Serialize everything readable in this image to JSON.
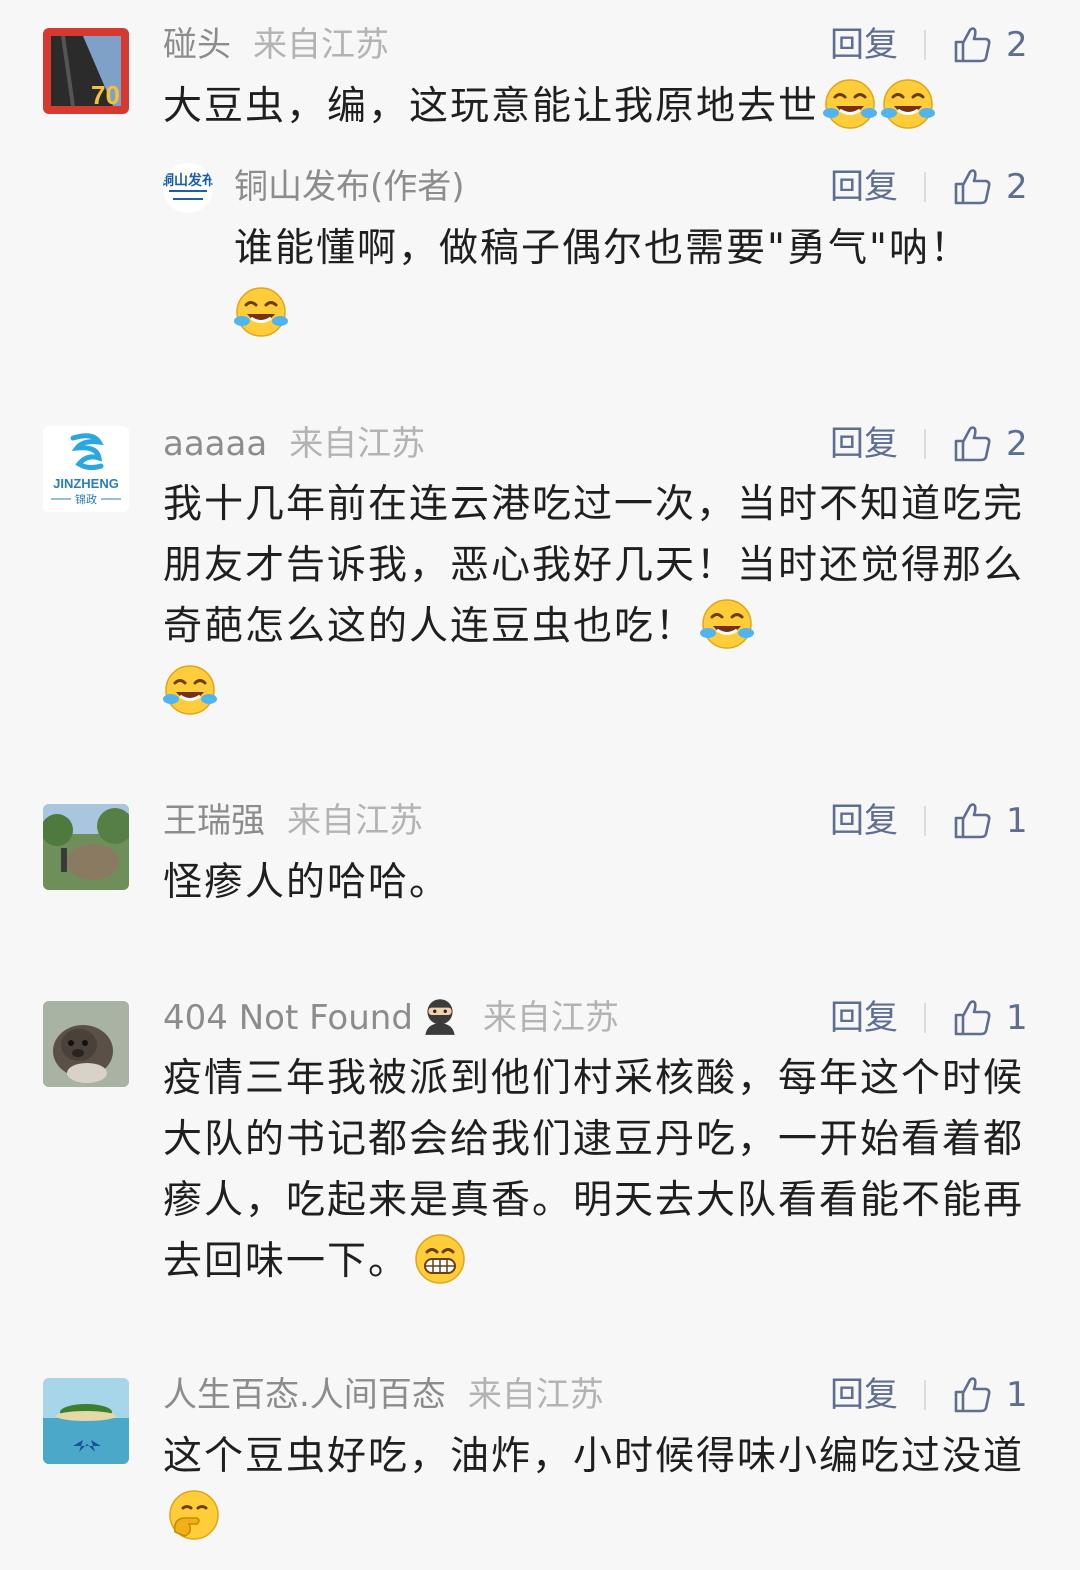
{
  "comments": [
    {
      "name": "碰头",
      "location": "来自江苏",
      "reply_label": "回复",
      "likes": "2",
      "text": "大豆虫，编，这玩意能让我原地去世",
      "emojis": [
        "laugh-cry",
        "laugh-cry"
      ],
      "reply": {
        "name": "铜山发布(作者)",
        "reply_label": "回复",
        "likes": "2",
        "text": "谁能懂啊，做稿子偶尔也需要\"勇气\"呐！",
        "emojis": [
          "laugh-cry"
        ],
        "avatar_text": "铜山发布"
      },
      "avatar_text": "70"
    },
    {
      "name": "aaaaa",
      "location": "来自江苏",
      "reply_label": "回复",
      "likes": "2",
      "text": "我十几年前在连云港吃过一次，当时不知道吃完朋友才告诉我，恶心我好几天！当时还觉得那么奇葩怎么这的人连豆虫也吃！",
      "emojis": [
        "laugh-cry",
        "laugh-cry"
      ],
      "avatar_text": "JINZHENG",
      "avatar_sub": "锦政"
    },
    {
      "name": "王瑞强",
      "location": "来自江苏",
      "reply_label": "回复",
      "likes": "1",
      "text": "怪瘆人的哈哈。",
      "emojis": []
    },
    {
      "name": "404 Not Found",
      "name_emoji": "ninja",
      "location": "来自江苏",
      "reply_label": "回复",
      "likes": "1",
      "text": "疫情三年我被派到他们村采核酸，每年这个时候大队的书记都会给我们逮豆丹吃，一开始看着都瘆人，吃起来是真香。明天去大队看看能不能再去回味一下。",
      "emojis": [
        "grin"
      ]
    },
    {
      "name": "人生百态.人间百态",
      "location": "来自江苏",
      "reply_label": "回复",
      "likes": "1",
      "text": "这个豆虫好吃，油炸，小时候得味小编吃过没道",
      "emojis": [
        "hand-over-mouth"
      ]
    }
  ],
  "colors": {
    "background": "#f7f7f7",
    "reply_link": "#5e6e91",
    "name": "#8c8c8c",
    "location": "#b3b3b3",
    "body": "#1f1f1f"
  }
}
